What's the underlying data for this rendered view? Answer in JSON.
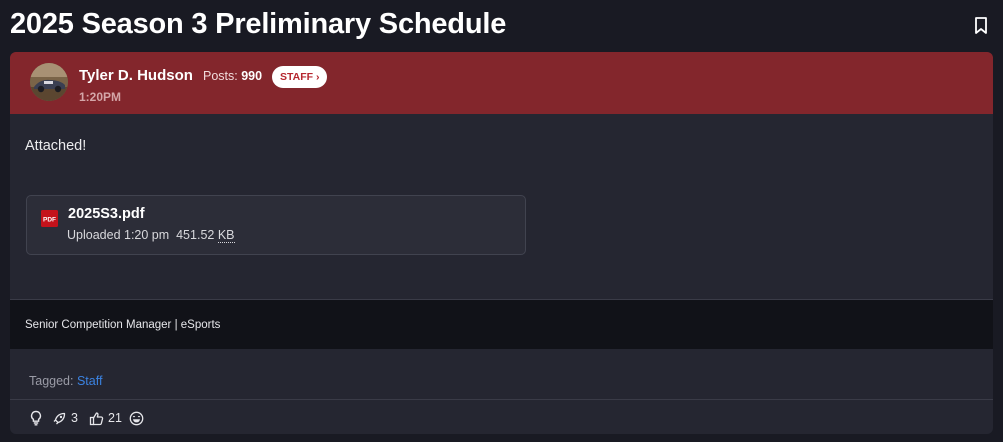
{
  "page": {
    "title": "2025 Season 3 Preliminary Schedule"
  },
  "post": {
    "author": {
      "name": "Tyler D. Hudson",
      "posts_label": "Posts:",
      "posts_count": "990",
      "badge": "STAFF ›"
    },
    "time": "1:20PM",
    "body": "Attached!",
    "attachment": {
      "file_name": "2025S3.pdf",
      "uploaded": "Uploaded 1:20 pm",
      "size_value": "451.52",
      "size_unit": "KB",
      "icon": "pdf-file-icon"
    },
    "signature": "Senior Competition Manager | eSports",
    "tags": {
      "label": "Tagged:",
      "items": [
        "Staff"
      ]
    },
    "actions": {
      "idea_icon": "lightbulb-icon",
      "seen_icon": "rocket-icon",
      "seen_count": "3",
      "likes_icon": "thumbs-up-icon",
      "likes_count": "21",
      "reactions_icon": "laughing-emoji-icon"
    }
  },
  "colors": {
    "header_bg": "#83262c",
    "page_bg": "#191a23",
    "card_bg": "#252631",
    "link": "#3b82e0",
    "badge_text": "#b5262f"
  }
}
